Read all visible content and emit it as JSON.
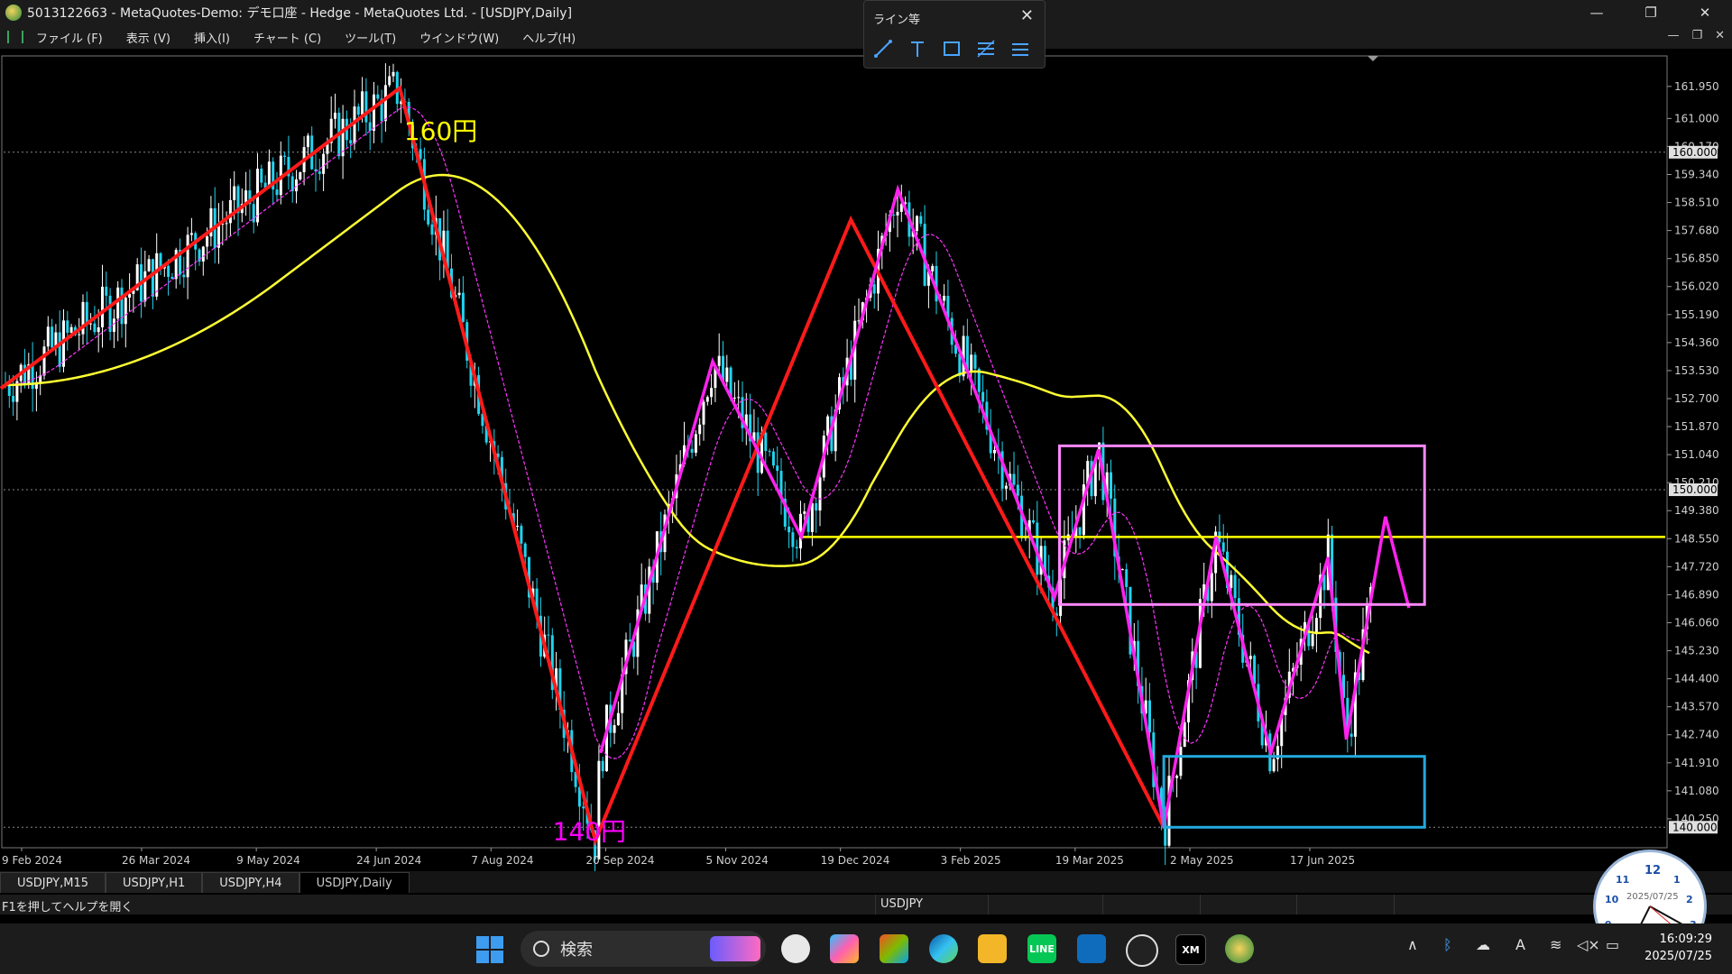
{
  "window": {
    "title": "5013122663 - MetaQuotes-Demo: デモ口座 - Hedge - MetaQuotes Ltd. - [USDJPY,Daily]",
    "controls": [
      "—",
      "❐",
      "✕"
    ]
  },
  "menu": {
    "items": [
      "ファイル (F)",
      "表示 (V)",
      "挿入(I)",
      "チャート (C)",
      "ツール(T)",
      "ウインドウ(W)",
      "ヘルプ(H)"
    ],
    "mdi_controls": [
      "—",
      "❐",
      "✕"
    ]
  },
  "line_toolbar": {
    "title": "ライン等",
    "close": "✕",
    "tools": [
      "trendline-icon",
      "text-icon",
      "rectangle-icon",
      "fibonacci-icon",
      "channel-icon"
    ]
  },
  "chart_data": {
    "type": "candlestick",
    "symbol": "USDJPY",
    "timeframe": "Daily",
    "annotations": [
      {
        "text": "160円",
        "color": "#ffff00",
        "date": "2024-07-15",
        "price": 160.0
      },
      {
        "text": "140円",
        "color": "#ff00ff",
        "date": "2024-09-10",
        "price": 140.0
      }
    ],
    "x_ticks": [
      "9 Feb 2024",
      "26 Mar 2024",
      "9 May 2024",
      "24 Jun 2024",
      "7 Aug 2024",
      "20 Sep 2024",
      "5 Nov 2024",
      "19 Dec 2024",
      "3 Feb 2025",
      "19 Mar 2025",
      "2 May 2025",
      "17 Jun 2025"
    ],
    "y_ticks": [
      "161.950",
      "161.000",
      "160.170",
      "159.340",
      "158.510",
      "157.680",
      "156.850",
      "156.020",
      "155.190",
      "154.360",
      "153.530",
      "152.700",
      "151.870",
      "151.040",
      "150.210",
      "149.380",
      "148.550",
      "147.720",
      "146.890",
      "146.060",
      "145.230",
      "144.400",
      "143.570",
      "142.740",
      "141.910",
      "141.080",
      "140.250"
    ],
    "horizontal_levels": [
      {
        "label": "160.000",
        "price": 160.0
      },
      {
        "label": "150.000",
        "price": 150.0
      },
      {
        "label": "140.000",
        "price": 140.0
      }
    ],
    "yellow_level": 148.6,
    "y_range": [
      139.5,
      162.8
    ],
    "zigzag_red": [
      {
        "date": "2024-02-01",
        "price": 153.0
      },
      {
        "date": "2024-07-03",
        "price": 161.9
      },
      {
        "date": "2024-09-16",
        "price": 139.6
      },
      {
        "date": "2024-12-23",
        "price": 158.0
      },
      {
        "date": "2025-04-22",
        "price": 140.0
      }
    ],
    "zigzag_magenta": [
      {
        "date": "2024-09-18",
        "price": 142.2
      },
      {
        "date": "2024-10-31",
        "price": 153.8
      },
      {
        "date": "2024-12-04",
        "price": 148.6
      },
      {
        "date": "2025-01-10",
        "price": 158.9
      },
      {
        "date": "2025-03-11",
        "price": 146.8
      },
      {
        "date": "2025-03-28",
        "price": 151.2
      },
      {
        "date": "2025-04-22",
        "price": 140.0
      },
      {
        "date": "2025-05-12",
        "price": 148.6
      },
      {
        "date": "2025-06-02",
        "price": 142.2
      },
      {
        "date": "2025-06-24",
        "price": 148.0
      },
      {
        "date": "2025-07-01",
        "price": 142.6
      },
      {
        "date": "2025-07-16",
        "price": 149.2
      },
      {
        "date": "2025-07-25",
        "price": 146.5
      }
    ],
    "zones": [
      {
        "name": "supply-zone",
        "color": "#ff88ff",
        "from": "2025-03-13",
        "to": "2025-07-31",
        "high": 151.3,
        "low": 146.6
      },
      {
        "name": "demand-zone",
        "color": "#22aadd",
        "from": "2025-04-22",
        "to": "2025-07-31",
        "high": 142.1,
        "low": 140.0
      }
    ],
    "grid": false,
    "background": "#000000"
  },
  "tabs": [
    "USDJPY,M15",
    "USDJPY,H1",
    "USDJPY,H4",
    "USDJPY,Daily"
  ],
  "status": {
    "help": "F1を押してヘルプを開く",
    "symbol": "USDJPY"
  },
  "taskbar": {
    "search_label": "検索",
    "time": "16:09:29",
    "date": "2025/07/25",
    "apps": [
      "clock-app-icon",
      "copilot-icon",
      "store-icon",
      "edge-icon",
      "explorer-icon",
      "line-icon",
      "outlook-icon",
      "app-icon",
      "xm-icon",
      "mt5-icon"
    ],
    "app_labels": {
      "line": "LINE",
      "xm": "XM"
    }
  },
  "clock_widget": {
    "date": "2025/07/25"
  }
}
